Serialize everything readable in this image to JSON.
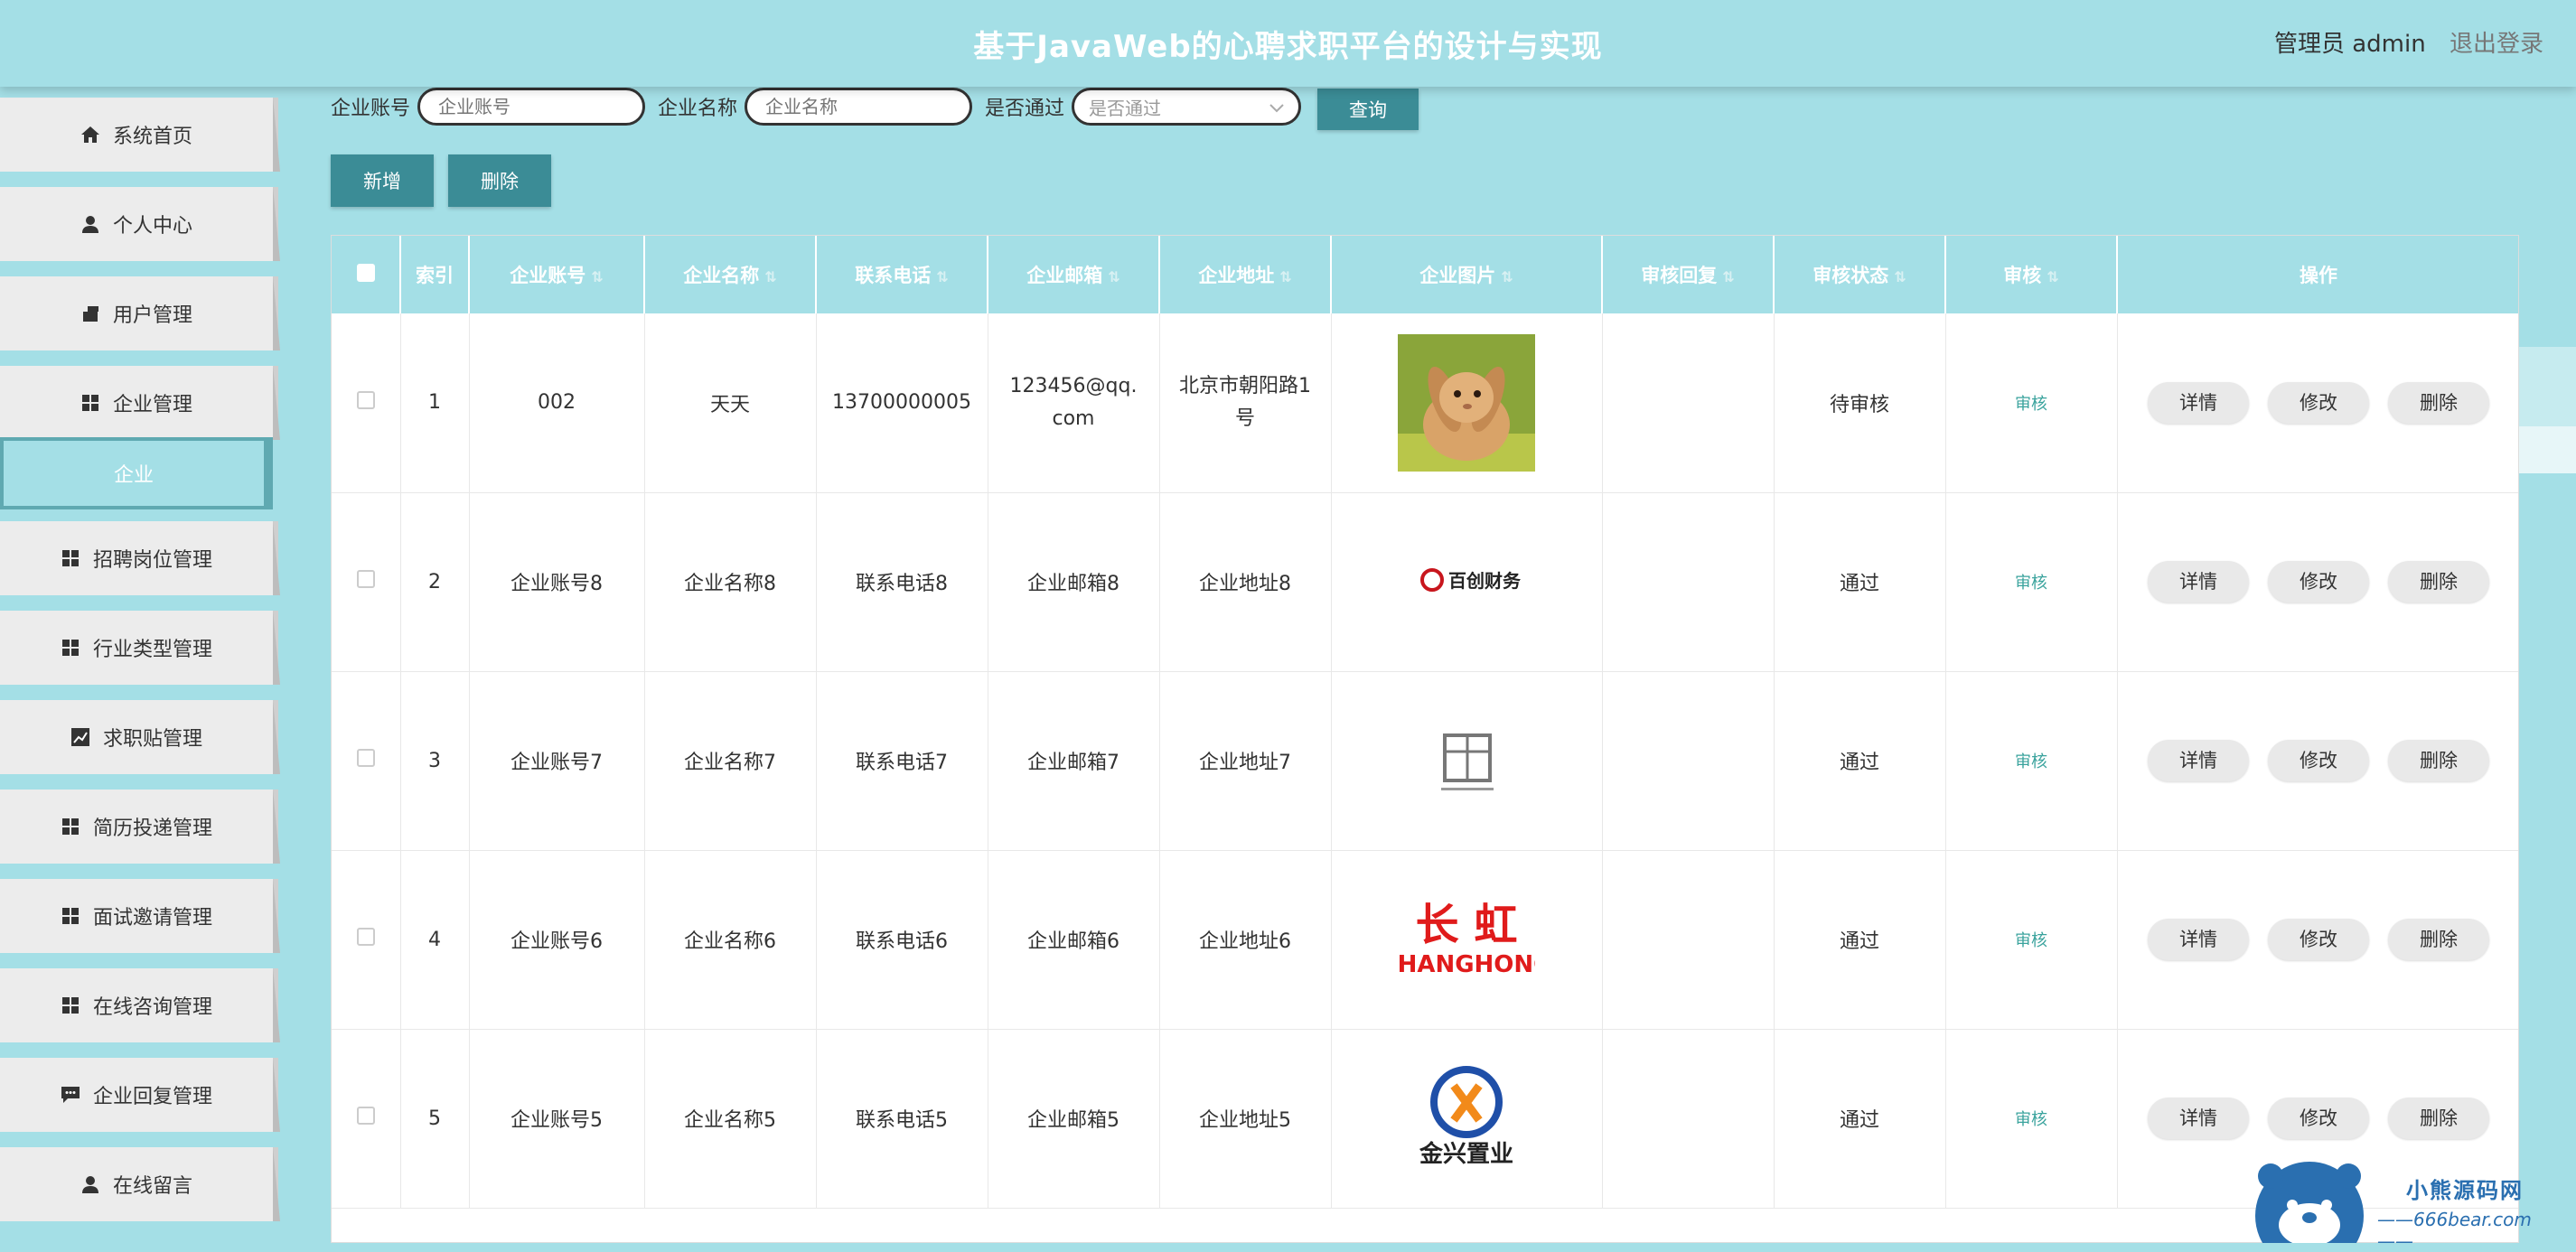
{
  "header": {
    "title": "基于JavaWeb的心聘求职平台的设计与实现",
    "user_role": "管理员 admin",
    "logout": "退出登录"
  },
  "sidebar": {
    "items": [
      {
        "label": "系统首页",
        "icon": "home-icon"
      },
      {
        "label": "个人中心",
        "icon": "user-icon"
      },
      {
        "label": "用户管理",
        "icon": "user-manage-icon"
      },
      {
        "label": "企业管理",
        "icon": "grid-icon"
      },
      {
        "label": "企业",
        "icon": ""
      },
      {
        "label": "招聘岗位管理",
        "icon": "grid-icon"
      },
      {
        "label": "行业类型管理",
        "icon": "grid-icon"
      },
      {
        "label": "求职贴管理",
        "icon": "chart-icon"
      },
      {
        "label": "简历投递管理",
        "icon": "grid-icon"
      },
      {
        "label": "面试邀请管理",
        "icon": "grid-icon"
      },
      {
        "label": "在线咨询管理",
        "icon": "grid-icon"
      },
      {
        "label": "企业回复管理",
        "icon": "chat-icon"
      },
      {
        "label": "在线留言",
        "icon": "user-icon"
      }
    ]
  },
  "search": {
    "account_label": "企业账号",
    "account_placeholder": "企业账号",
    "name_label": "企业名称",
    "name_placeholder": "企业名称",
    "pass_label": "是否通过",
    "pass_placeholder": "是否通过",
    "query_button": "查询"
  },
  "actions": {
    "add": "新增",
    "delete": "删除"
  },
  "table": {
    "headers": [
      "索引",
      "企业账号",
      "企业名称",
      "联系电话",
      "企业邮箱",
      "企业地址",
      "企业图片",
      "审核回复",
      "审核状态",
      "审核",
      "操作"
    ],
    "rows": [
      {
        "index": "1",
        "account": "002",
        "name": "天天",
        "phone": "13700000005",
        "email": "123456@qq.com",
        "address": "北京市朝阳路1号",
        "image": "rabbit-image",
        "reply": "",
        "status": "待审核",
        "audit": "审核"
      },
      {
        "index": "2",
        "account": "企业账号8",
        "name": "企业名称8",
        "phone": "联系电话8",
        "email": "企业邮箱8",
        "address": "企业地址8",
        "image": "baichuang-logo",
        "reply": "",
        "status": "通过",
        "audit": "审核"
      },
      {
        "index": "3",
        "account": "企业账号7",
        "name": "企业名称7",
        "phone": "联系电话7",
        "email": "企业邮箱7",
        "address": "企业地址7",
        "image": "seal-logo",
        "reply": "",
        "status": "通过",
        "audit": "审核"
      },
      {
        "index": "4",
        "account": "企业账号6",
        "name": "企业名称6",
        "phone": "联系电话6",
        "email": "企业邮箱6",
        "address": "企业地址6",
        "image": "changhong-logo",
        "reply": "",
        "status": "通过",
        "audit": "审核"
      },
      {
        "index": "5",
        "account": "企业账号5",
        "name": "企业名称5",
        "phone": "联系电话5",
        "email": "企业邮箱5",
        "address": "企业地址5",
        "image": "jinxing-logo",
        "reply": "",
        "status": "通过",
        "audit": "审核"
      }
    ],
    "ops": {
      "detail": "详情",
      "edit": "修改",
      "remove": "删除"
    }
  },
  "logos": {
    "baichuang": "百创财务",
    "changhong_cn": "长 虹",
    "changhong_en": "CHANGHONG",
    "jinxing": "金兴置业"
  },
  "watermark": {
    "cn": "小熊源码网",
    "url": "——666bear.com——"
  },
  "colors": {
    "theme": "#a4dfe6",
    "button_dark": "#3b8c96",
    "audit_link": "#3aa39d"
  }
}
